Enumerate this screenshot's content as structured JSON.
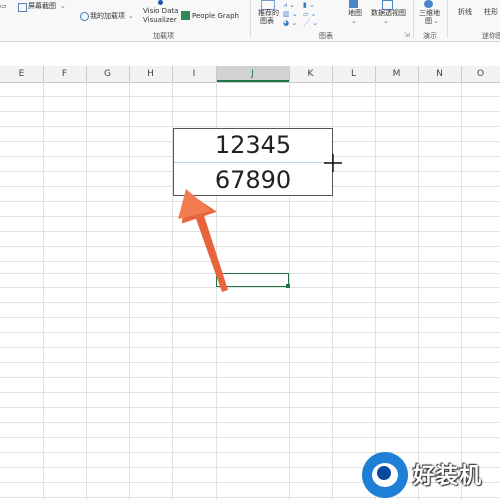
{
  "ribbon": {
    "items": [
      {
        "label": "屏幕截图"
      },
      {
        "label": "我的加载项"
      },
      {
        "label": "Visio Data"
      },
      {
        "label": "Visualizer"
      },
      {
        "label": "People Graph"
      },
      {
        "label": "推荐的"
      },
      {
        "label": "图表"
      },
      {
        "label": "地图"
      },
      {
        "label": "数据透视图"
      },
      {
        "label": "三维地"
      },
      {
        "label": "图"
      },
      {
        "label": "折线"
      },
      {
        "label": "柱形"
      }
    ],
    "groups": {
      "addins": "加载项",
      "charts": "图表",
      "tours": "演示",
      "sparklines": "迷你图"
    }
  },
  "sheet": {
    "columns": [
      "E",
      "F",
      "G",
      "H",
      "I",
      "J",
      "K",
      "L",
      "M",
      "N",
      "O"
    ],
    "selected_column": "J"
  },
  "textbox": {
    "line1": "12345",
    "line2": "67890"
  },
  "watermark": {
    "text": "好装机"
  },
  "colors": {
    "excel_green": "#217346",
    "arrow": "#e8643c",
    "watermark_blue": "#1e7fd6"
  }
}
